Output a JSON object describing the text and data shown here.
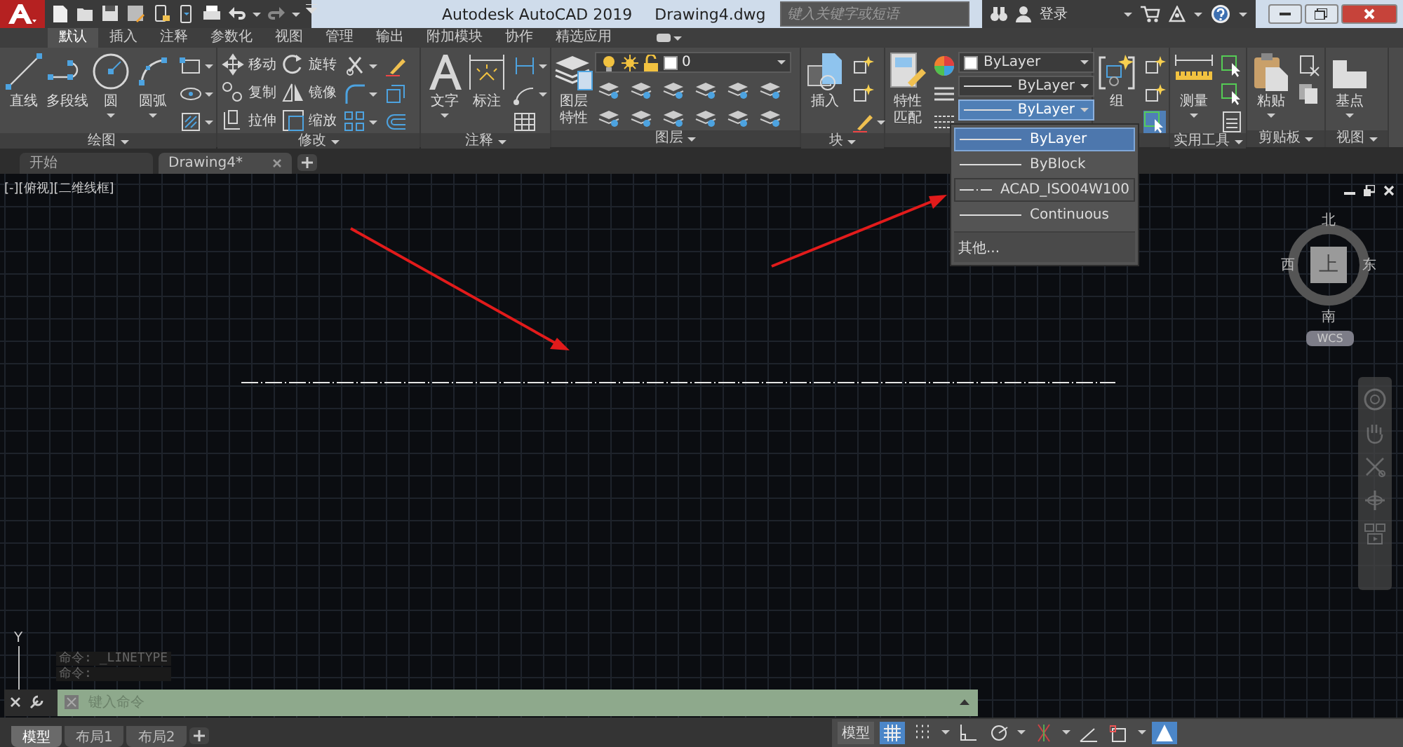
{
  "title_bar": {
    "title": "Autodesk AutoCAD 2019",
    "file": "Drawing4.dwg",
    "search": {
      "placeholder": "键入关键字或短语"
    },
    "login": "登录"
  },
  "ribbon_tabs": [
    {
      "label": "默认",
      "selected": true
    },
    {
      "label": "插入",
      "selected": false
    },
    {
      "label": "注释",
      "selected": false
    },
    {
      "label": "参数化",
      "selected": false
    },
    {
      "label": "视图",
      "selected": false
    },
    {
      "label": "管理",
      "selected": false
    },
    {
      "label": "输出",
      "selected": false
    },
    {
      "label": "附加模块",
      "selected": false
    },
    {
      "label": "协作",
      "selected": false
    },
    {
      "label": "精选应用",
      "selected": false
    }
  ],
  "ribbon_panels": [
    {
      "title": "绘图",
      "large": [
        {
          "label": "直线",
          "menu": false
        },
        {
          "label": "多段线",
          "menu": false
        },
        {
          "label": "圆",
          "menu": true
        },
        {
          "label": "圆弧",
          "menu": true
        }
      ]
    },
    {
      "title": "修改",
      "small": [
        "移动",
        "旋转",
        "复制",
        "镜像",
        "拉伸",
        "缩放"
      ]
    },
    {
      "title": "注释",
      "large": [
        {
          "label": "文字",
          "menu": true
        },
        {
          "label": "标注",
          "menu": false
        }
      ]
    },
    {
      "title": "图层",
      "large": [
        {
          "label": "图层特性",
          "menu": false
        }
      ],
      "layer": "0"
    },
    {
      "title": "块",
      "large": [
        {
          "label": "插入",
          "menu": false
        }
      ]
    },
    {
      "large": [
        {
          "label": "特性匹配",
          "menu": false
        }
      ],
      "dropdowns": [
        {
          "value": "ByLayer",
          "kind": "color",
          "expanded": false
        },
        {
          "value": "ByLayer",
          "kind": "line",
          "expanded": false
        },
        {
          "value": "ByLayer",
          "kind": "line",
          "expanded": true
        }
      ]
    },
    {
      "large": [
        {
          "label": "组",
          "menu": false
        }
      ]
    },
    {
      "title": "实用工具",
      "large": [
        {
          "label": "测量",
          "menu": true
        }
      ]
    },
    {
      "title": "剪贴板",
      "large": [
        {
          "label": "粘贴",
          "menu": true
        }
      ]
    },
    {
      "title": "视图",
      "large": [
        {
          "label": "基点",
          "menu": true
        }
      ]
    }
  ],
  "dropdown_list": {
    "items": [
      {
        "label": "ByLayer",
        "kind": "solid",
        "selected": true
      },
      {
        "label": "ByBlock",
        "kind": "solid",
        "selected": false
      },
      {
        "label": "ACAD_ISO04W100",
        "kind": "dashed",
        "selected": false
      },
      {
        "label": "Continuous",
        "kind": "solid",
        "selected": false
      }
    ],
    "more": "其他..."
  },
  "file_tabs": [
    {
      "label": "开始",
      "selected": false,
      "closable": false
    },
    {
      "label": "Drawing4*",
      "selected": true,
      "closable": true
    }
  ],
  "viewport": {
    "label": "[-][俯视][二维线框]",
    "viewcube": {
      "north": "北",
      "south": "南",
      "east": "东",
      "west": "西",
      "face": "上",
      "ucs": "WCS"
    },
    "ucs_axis": "Y",
    "command_history": [
      "命令: _LINETYPE",
      "命令:"
    ],
    "command_line": {
      "placeholder": "键入命令"
    }
  },
  "layout_tabs": [
    {
      "label": "模型",
      "selected": true
    },
    {
      "label": "布局1",
      "selected": false
    },
    {
      "label": "布局2",
      "selected": false
    }
  ],
  "status_bar": {
    "model": "模型",
    "toggles": [
      {
        "on": true
      },
      {
        "on": false
      },
      {
        "on": false
      },
      {
        "on": false
      },
      {
        "on": false
      },
      {
        "on": false
      },
      {
        "on": false
      },
      {
        "on": true
      }
    ]
  }
}
